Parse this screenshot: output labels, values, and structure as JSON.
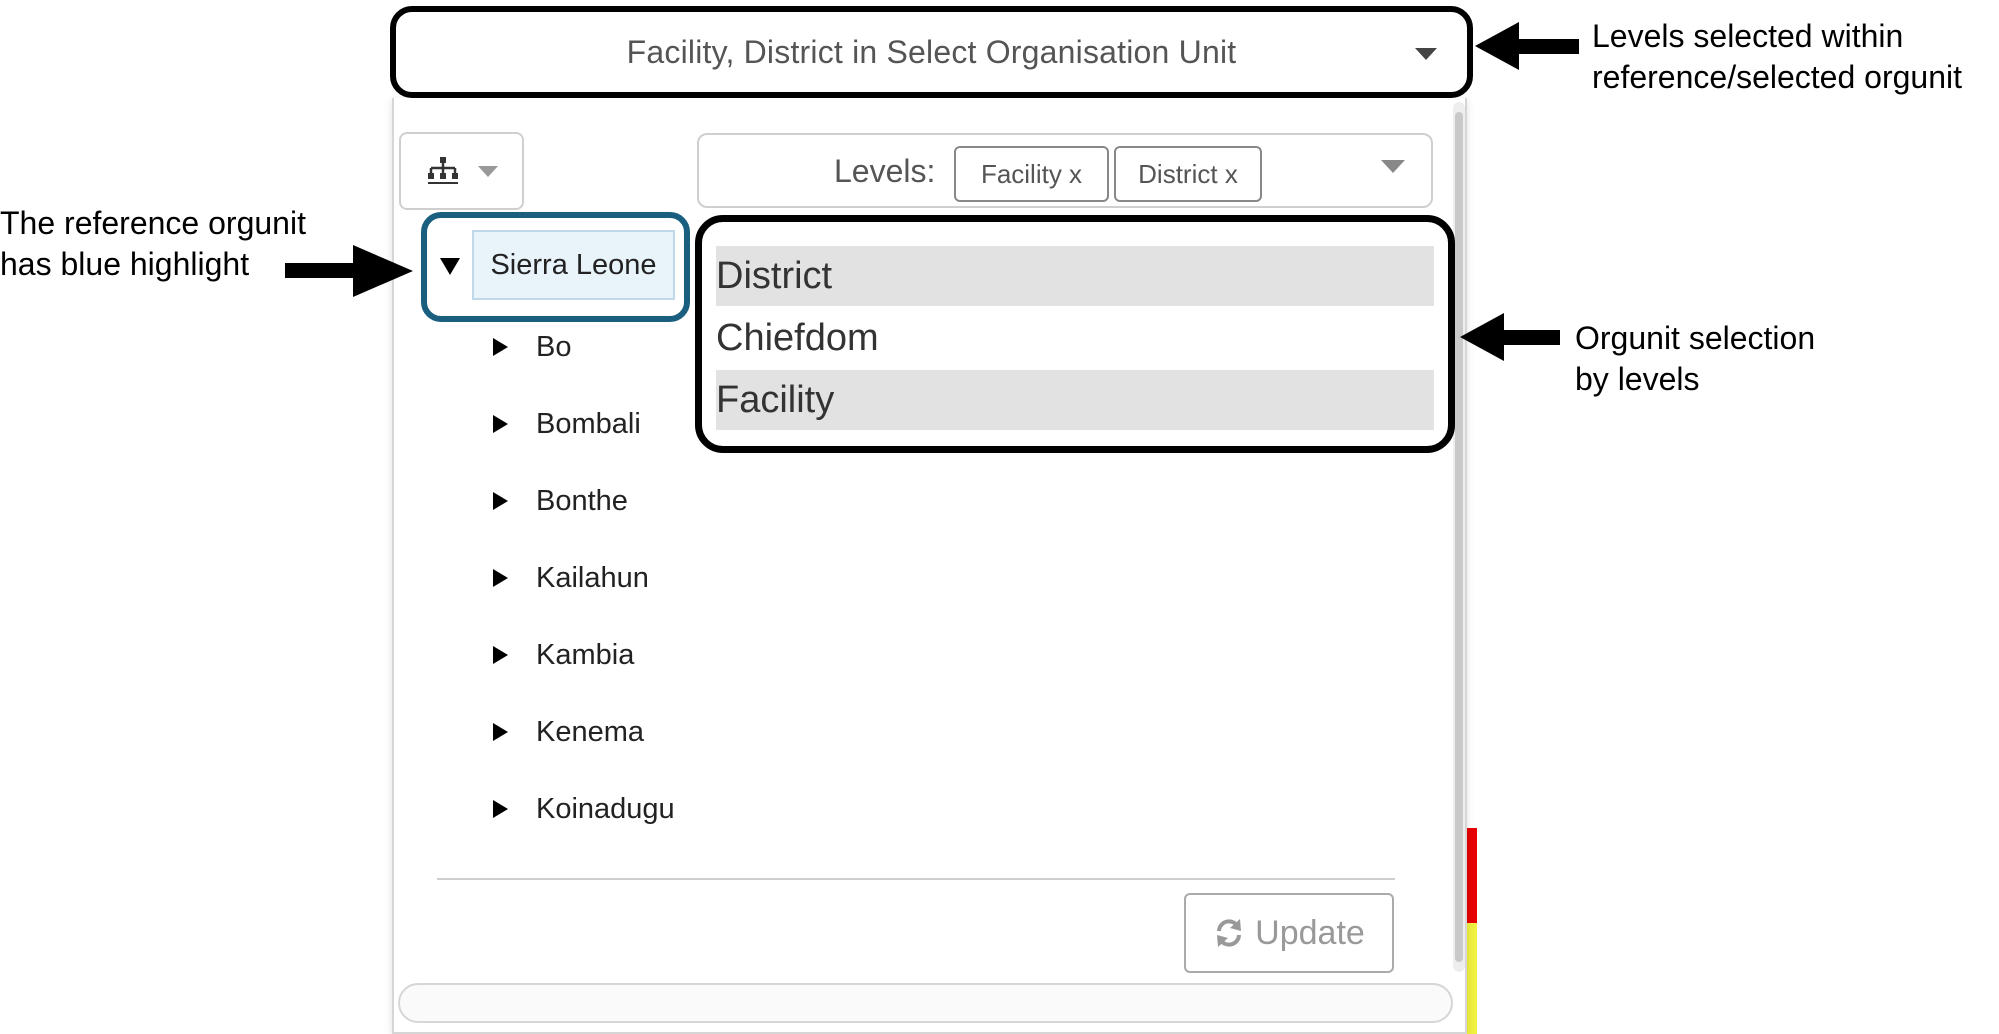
{
  "top_select": {
    "text": "Facility, District in Select Organisation Unit",
    "icon": "chevron-down-icon"
  },
  "hierarchy_button": {
    "icon": "org-tree-icon",
    "caret": "chevron-down-icon"
  },
  "levels_select": {
    "label": "Levels:",
    "chips": [
      "Facility x",
      "District x"
    ],
    "caret": "chevron-down-icon"
  },
  "level_options": [
    {
      "label": "District",
      "selected": true
    },
    {
      "label": "Chiefdom",
      "selected": false
    },
    {
      "label": "Facility",
      "selected": true
    }
  ],
  "tree": {
    "root": {
      "label": "Sierra Leone",
      "expanded": true,
      "highlighted": true
    },
    "children": [
      "Bo",
      "Bombali",
      "Bonthe",
      "Kailahun",
      "Kambia",
      "Kenema",
      "Koinadugu"
    ]
  },
  "update_button": {
    "label": "Update",
    "icon": "refresh-icon"
  },
  "annotations": {
    "top_right": [
      "Levels selected within",
      "reference/selected orgunit"
    ],
    "left": [
      "The reference orgunit",
      "has blue highlight"
    ],
    "right_mid": [
      "Orgunit selection",
      "by levels"
    ]
  },
  "colors": {
    "highlight_border": "#1a5f80",
    "root_bg": "#e8f3fa",
    "selected_option_bg": "#e2e2e2"
  }
}
